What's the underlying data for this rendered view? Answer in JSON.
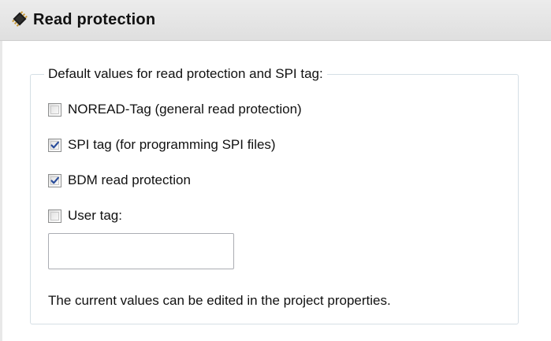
{
  "header": {
    "title": "Read protection",
    "icon": "chip-icon"
  },
  "group": {
    "legend": "Default values for read protection and SPI tag:"
  },
  "options": [
    {
      "label": "NOREAD-Tag (general read protection)",
      "checked": false
    },
    {
      "label": "SPI tag (for programming SPI files)",
      "checked": true
    },
    {
      "label": "BDM read protection",
      "checked": true
    },
    {
      "label": "User tag:",
      "checked": false
    }
  ],
  "user_tag": {
    "value": "",
    "placeholder": ""
  },
  "note": "The current values can be edited in the project properties.",
  "colors": {
    "check_mark": "#2a4d9b",
    "group_border": "#d5dfe5",
    "header_bg": "#e4e4e4"
  }
}
